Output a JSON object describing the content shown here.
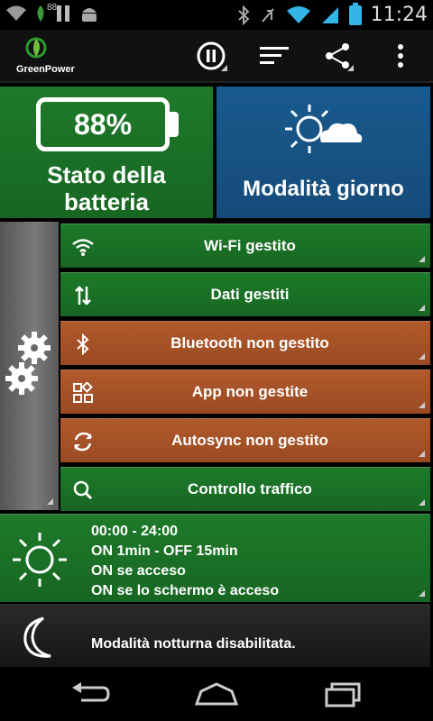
{
  "status": {
    "signal_number": "88",
    "clock": "11:24"
  },
  "appbar": {
    "logo_text": "GreenPower"
  },
  "tiles": {
    "battery_percent": "88%",
    "battery_label_1": "Stato della",
    "battery_label_2": "batteria",
    "mode_label": "Modalità giorno"
  },
  "rows": [
    {
      "label": "Wi-Fi gestito",
      "icon": "wifi-icon",
      "state": "green"
    },
    {
      "label": "Dati gestiti",
      "icon": "data-arrows-icon",
      "state": "green"
    },
    {
      "label": "Bluetooth non gestito",
      "icon": "bluetooth-icon",
      "state": "orange"
    },
    {
      "label": "App non gestite",
      "icon": "apps-icon",
      "state": "orange"
    },
    {
      "label": "Autosync non gestito",
      "icon": "sync-icon",
      "state": "orange"
    },
    {
      "label": "Controllo traffico",
      "icon": "search-icon",
      "state": "green"
    }
  ],
  "schedule": {
    "line1": "00:00 - 24:00",
    "line2": "ON 1min - OFF 15min",
    "line3": "ON se acceso",
    "line4": "ON se lo schermo è acceso"
  },
  "night": {
    "text": "Modalità notturna disabilitata."
  },
  "colors": {
    "green": "#1e7a2a",
    "orange": "#b05a2c",
    "blue": "#1a5a8e",
    "status_blue": "#33b5e5"
  }
}
